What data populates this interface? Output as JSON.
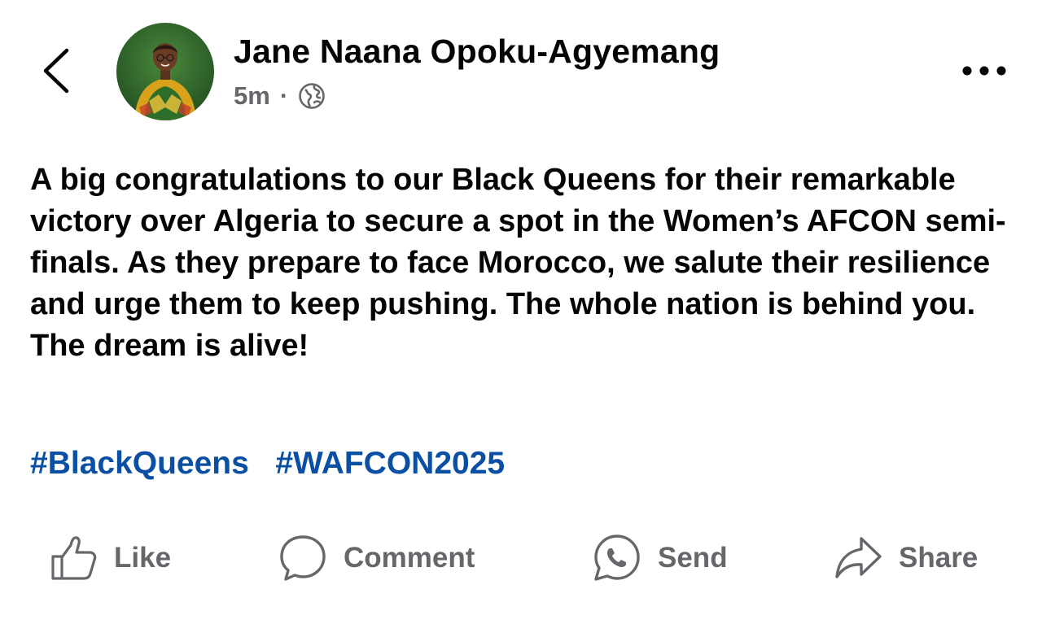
{
  "post": {
    "author_name": "Jane Naana Opoku-Agyemang",
    "timestamp": "5m",
    "separator": "·",
    "audience_icon": "globe-icon",
    "body_text": "A big congratulations to our Black Queens for their remarkable victory over Algeria to secure a spot in the Women’s AFCON semi-finals. As they prepare to face Morocco, we salute their resilience and urge them to keep pushing. The whole nation is behind you. The dream is alive!",
    "hashtags": [
      "#BlackQueens",
      "#WAFCON2025"
    ]
  },
  "header": {
    "back_icon": "chevron-left-icon",
    "more_icon": "more-horizontal-icon"
  },
  "actions": [
    {
      "label": "Like",
      "icon": "thumbs-up-icon"
    },
    {
      "label": "Comment",
      "icon": "comment-bubble-icon"
    },
    {
      "label": "Send",
      "icon": "whatsapp-icon"
    },
    {
      "label": "Share",
      "icon": "share-arrow-icon"
    }
  ],
  "colors": {
    "text_primary": "#050505",
    "text_secondary": "#65676b",
    "hashtag": "#0a4fa3",
    "background": "#ffffff"
  }
}
